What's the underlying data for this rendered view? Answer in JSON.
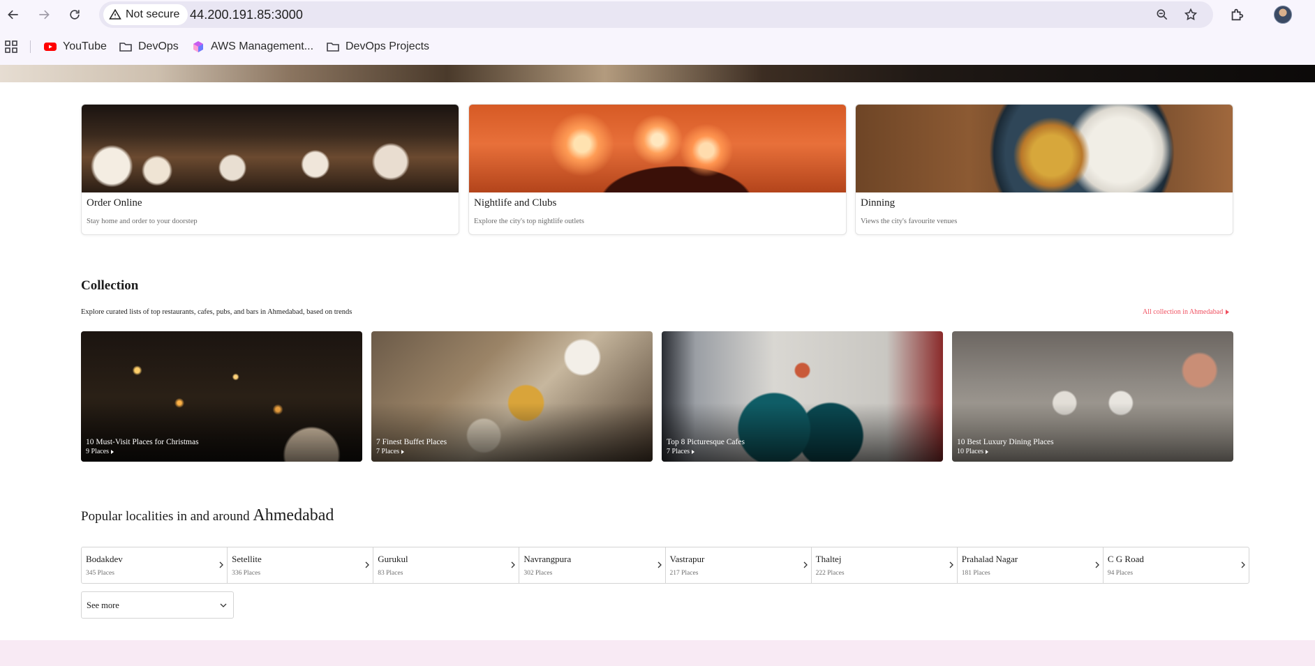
{
  "browser": {
    "security_label": "Not secure",
    "url": "44.200.191.85:3000",
    "bookmarks": [
      {
        "label": "YouTube",
        "icon": "youtube-icon"
      },
      {
        "label": "DevOps",
        "icon": "folder-icon"
      },
      {
        "label": "AWS Management...",
        "icon": "aws-cube-icon"
      },
      {
        "label": "DevOps Projects",
        "icon": "folder-icon"
      }
    ]
  },
  "features": [
    {
      "title": "Order Online",
      "subtitle": "Stay home and order to your doorstep"
    },
    {
      "title": "Nightlife and Clubs",
      "subtitle": "Explore the city's top nightlife outlets"
    },
    {
      "title": "Dinning",
      "subtitle": "Views the city's favourite venues"
    }
  ],
  "collection": {
    "title": "Collection",
    "description": "Explore curated lists of top restaurants, cafes, pubs, and bars in Ahmedabad, based on trends",
    "all_link": "All collection in Ahmedabad",
    "items": [
      {
        "name": "10 Must-Visit Places for Christmas",
        "count": "9 Places"
      },
      {
        "name": "7 Finest Buffet Places",
        "count": "7 Places"
      },
      {
        "name": "Top 8 Picturesque Cafes",
        "count": "7 Places"
      },
      {
        "name": "10 Best Luxury Dining Places",
        "count": "10 Places"
      }
    ]
  },
  "localities": {
    "title_prefix": "Popular localities in and around ",
    "city": "Ahmedabad",
    "items": [
      {
        "name": "Bodakdev",
        "count": "345 Places"
      },
      {
        "name": "Setellite",
        "count": "336 Places"
      },
      {
        "name": "Gurukul",
        "count": "83 Places"
      },
      {
        "name": "Navrangpura",
        "count": "302 Places"
      },
      {
        "name": "Vastrapur",
        "count": "217 Places"
      },
      {
        "name": "Thaltej",
        "count": "222 Places"
      },
      {
        "name": "Prahalad Nagar",
        "count": "181 Places"
      },
      {
        "name": "C G Road",
        "count": "94 Places"
      }
    ],
    "see_more": "See more"
  },
  "colors": {
    "accent": "#ef4f5f",
    "footer": "#f8eaf4"
  }
}
